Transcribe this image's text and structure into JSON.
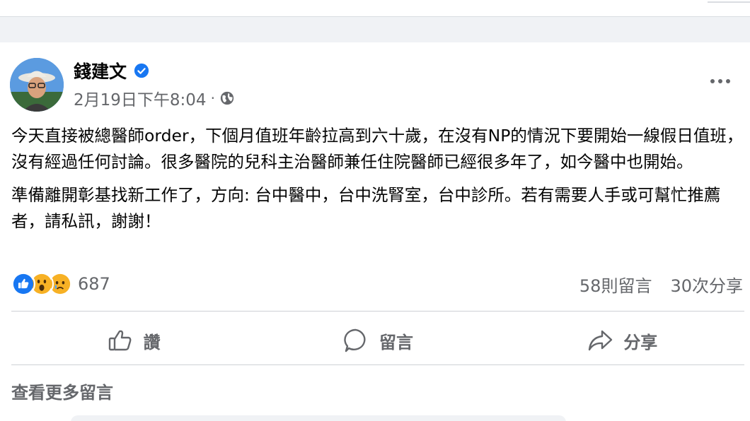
{
  "post": {
    "author": "錢建文",
    "timestamp": "2月19日下午8:04",
    "separator": "·",
    "paragraphs": [
      "今天直接被總醫師order，下個月值班年齡拉高到六十歲，在沒有NP的情況下要開始一線假日值班，沒有經過任何討論。很多醫院的兒科主治醫師兼任住院醫師已經很多年了，如今醫中也開始。",
      "準備離開彰基找新工作了，方向: 台中醫中，台中洗腎室，台中診所。若有需要人手或可幫忙推薦者，請私訊，謝謝！"
    ],
    "reactions": {
      "icons": [
        "like-icon",
        "wow-icon",
        "sad-icon"
      ],
      "count": "687"
    },
    "comments_count": "58則留言",
    "shares_count": "30次分享",
    "actions": {
      "like": "讚",
      "comment": "留言",
      "share": "分享"
    },
    "see_more_comments": "查看更多留言"
  },
  "colors": {
    "verified": "#1877f2",
    "like": "#1877f2",
    "wow_sad": "#f7b125",
    "secondary_text": "#65676b"
  }
}
